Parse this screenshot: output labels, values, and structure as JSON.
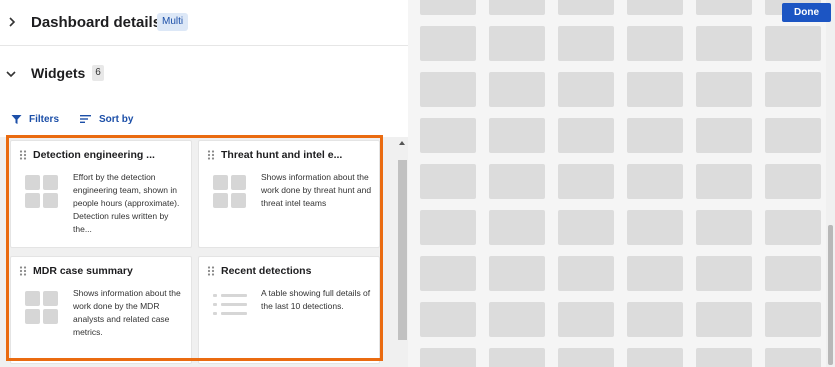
{
  "header": {
    "title": "Dashboard details",
    "badge": "Multi",
    "done_label": "Done"
  },
  "widgets_section": {
    "title": "Widgets",
    "count": "6"
  },
  "toolbar": {
    "filters_label": "Filters",
    "sort_label": "Sort by"
  },
  "widgets": [
    {
      "title": "Detection engineering ...",
      "description": "Effort by the detection engineering team, shown in people hours (approximate). Detection rules written by the...",
      "icon": "grid-widget-icon"
    },
    {
      "title": "Threat hunt and intel e...",
      "description": "Shows information about the work done by threat hunt and threat intel teams",
      "icon": "grid-widget-icon"
    },
    {
      "title": "MDR case summary",
      "description": "Shows information about the work done by the MDR analysts and related case metrics.",
      "icon": "grid-widget-icon"
    },
    {
      "title": "Recent detections",
      "description": "A table showing full details of the last 10 detections.",
      "icon": "table-widget-icon"
    }
  ],
  "colors": {
    "accent": "#1c55c3",
    "highlight": "#ea6b10",
    "badge_bg": "#dde8f7"
  }
}
